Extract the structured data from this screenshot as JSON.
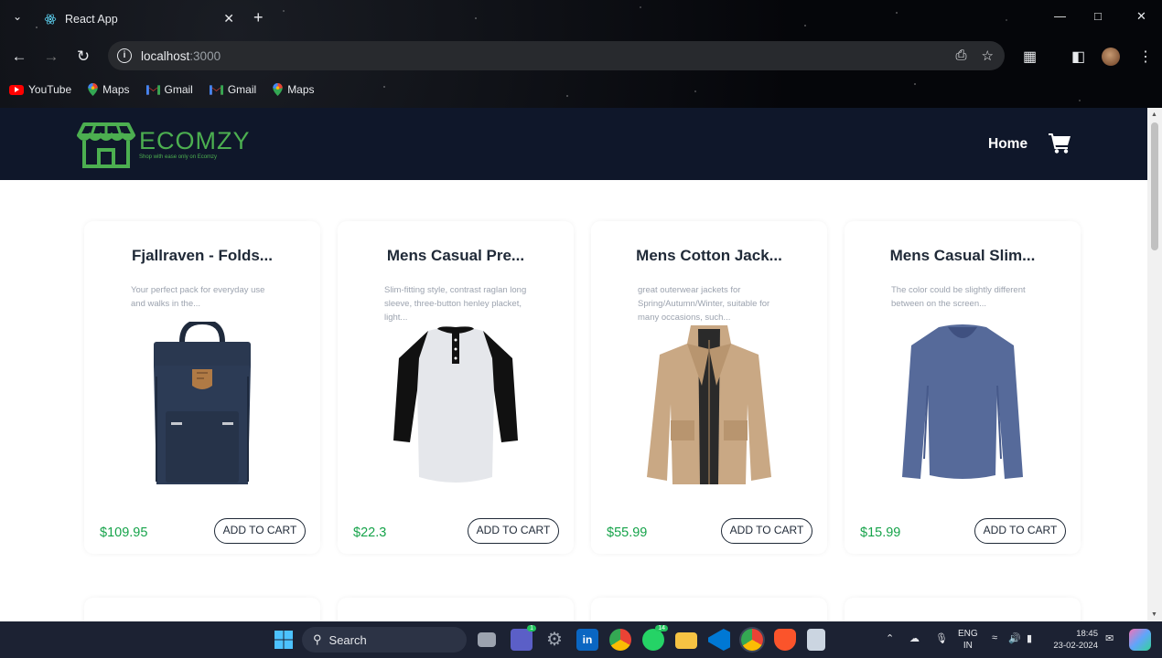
{
  "browser": {
    "tab_title": "React App",
    "url_host": "localhost",
    "url_port": ":3000",
    "bookmarks": [
      {
        "label": "YouTube",
        "icon": "youtube-icon"
      },
      {
        "label": "Maps",
        "icon": "maps-icon"
      },
      {
        "label": "Gmail",
        "icon": "gmail-icon"
      },
      {
        "label": "Gmail",
        "icon": "gmail-icon"
      },
      {
        "label": "Maps",
        "icon": "maps-icon"
      }
    ]
  },
  "site": {
    "logo_name": "ECOMZY",
    "logo_tagline": "Shop with ease only on Ecomzy",
    "nav_home": "Home",
    "brand_color": "#4caf50",
    "navbar_color": "#0f172a",
    "price_color": "#16a34a"
  },
  "products": [
    {
      "title": "Fjallraven - Folds...",
      "description": "Your perfect pack for everyday use and walks in the...",
      "price": "$109.95",
      "button": "ADD TO CART",
      "image": "backpack"
    },
    {
      "title": "Mens Casual Pre...",
      "description": "Slim-fitting style, contrast raglan long sleeve, three-button henley placket, light...",
      "price": "$22.3",
      "button": "ADD TO CART",
      "image": "henley-shirt"
    },
    {
      "title": "Mens Cotton Jack...",
      "description": "great outerwear jackets for Spring/Autumn/Winter, suitable for many occasions, such...",
      "price": "$55.99",
      "button": "ADD TO CART",
      "image": "cotton-jacket"
    },
    {
      "title": "Mens Casual Slim...",
      "description": "The color could be slightly different between on the screen...",
      "price": "$15.99",
      "button": "ADD TO CART",
      "image": "long-sleeve-tshirt"
    }
  ],
  "taskbar": {
    "search_label": "Search",
    "lang_line1": "ENG",
    "lang_line2": "IN",
    "time": "18:45",
    "date": "23-02-2024",
    "whatsapp_badge": "14",
    "teams_badge": "1"
  }
}
